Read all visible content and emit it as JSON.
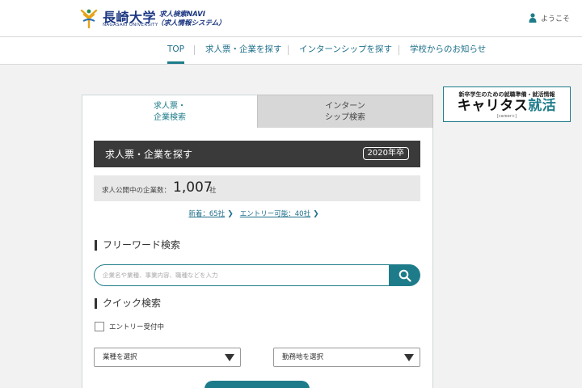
{
  "header": {
    "logo_jp": "長崎大学",
    "logo_en": "NAGASAKI UNIVERSITY",
    "logo_sub1": "求人検索NAVI",
    "logo_sub2": "（求人情報システム）",
    "welcome": "ようこそ"
  },
  "nav": {
    "items": [
      {
        "label": "TOP",
        "active": true
      },
      {
        "label": "求人票・企業を探す"
      },
      {
        "label": "インターンシップを探す"
      },
      {
        "label": "学校からのお知らせ"
      }
    ]
  },
  "banner": {
    "top": "新卒学生のための就職準備・就活情報",
    "main_a": "キャリタス",
    "main_b": "就活",
    "sub": "[career+]"
  },
  "tabs": {
    "job_line1": "求人票・",
    "job_line2": "企業検索",
    "intern_line1": "インターン",
    "intern_line2": "シップ検索"
  },
  "find": {
    "title": "求人票・企業を探す",
    "year": "2020年卒",
    "count_label": "求人公開中の企業数：",
    "count_value": "1,007",
    "count_unit": "社",
    "new_link": "新着：65社",
    "entry_link": "エントリー可能：40社"
  },
  "freeword": {
    "title": "フリーワード検索",
    "placeholder": "企業名や業種、事業内容、職種などを入力"
  },
  "quick": {
    "title": "クイック検索",
    "checkbox_label": "エントリー受付中",
    "industry_select": "業種を選択",
    "location_select": "勤務地を選択"
  },
  "colors": {
    "accent": "#1e7c8a",
    "brand": "#1a3580",
    "dark_bar": "#3a3a3a"
  },
  "icons": {
    "user": "user-icon",
    "search": "search-icon",
    "chevron": "chevron-right-icon",
    "dropdown": "triangle-down-icon"
  }
}
